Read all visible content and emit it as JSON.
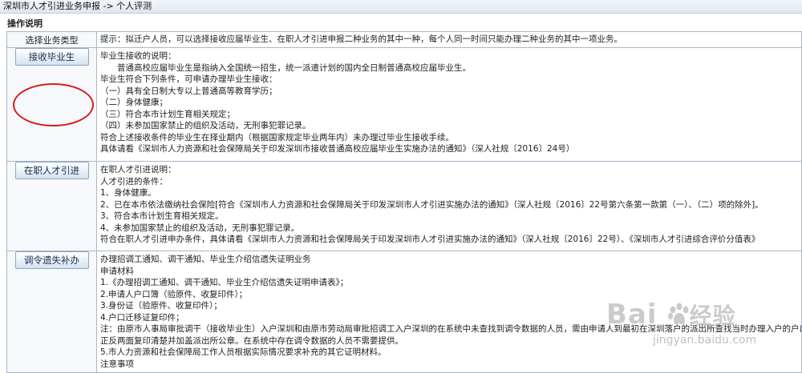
{
  "breadcrumb": "深圳市人才引进业务申报 -> 个人评测",
  "section_title": "操作说明",
  "header_row": {
    "label": "选择业务类型",
    "hint": "提示：拟迁户人员，可以选择接收应届毕业生、在职人才引进申报二种业务的其中一种，每个人同一时间只能办理二种业务的其中一项业务。"
  },
  "rows": [
    {
      "button": "接收毕业生",
      "lines": [
        "毕业生接收的说明：",
        "　　普通高校应届毕业生是指纳入全国统一招生，统一派遣计划的国内全日制普通高校应届毕业生。",
        "毕业生符合下列条件，可申请办理毕业生接收：",
        "（一）具有全日制大专以上普通高等教育学历；",
        "（二）身体健康；",
        "（三）符合本市计划生育相关规定；",
        "（四）未参加国家禁止的组织及活动，无刑事犯罪记录。",
        "符合上述接收条件的毕业生在择业期内（根据国家规定毕业两年内）未办理过毕业生接收手续。",
        "具体请看《深圳市人力资源和社会保障局关于印发深圳市接收普通高校应届毕业生实施办法的通知》（深人社规〔2016〕24号）"
      ]
    },
    {
      "button": "在职人才引进",
      "lines": [
        "在职人才引进说明：",
        "人才引进的条件：",
        "1、身体健康。",
        "2、已在本市依法缴纳社会保险[符合《深圳市人力资源和社会保障局关于印发深圳市人才引进实施办法的通知》（深人社规〔2016〕22号第六条第一款第（一）、（二）项的除外]。",
        "3、符合本市计划生育相关规定。",
        "4、未参加国家禁止的组织及活动，无刑事犯罪记录。",
        "符合在职人才引进申办条件，具体请看《深圳市人力资源和社会保障局关于印发深圳市人才引进实施办法的通知》（深人社规〔2016〕22号）、《深圳市人才引进综合评价分值表》"
      ]
    },
    {
      "button": "调令遗失补办",
      "lines": [
        "办理招调工通知、调干通知、毕业生介绍信遗失证明业务",
        "申请材料",
        "1.《办理招调工通知、调干通知、毕业生介绍信遗失证明申请表》；",
        "2.申请人户口簿（验原件、收复印件）；",
        "3.身份证（验原件、收复印件）；",
        "4.户口迁移证复印件；",
        "注：由原市人事局审批调干（接收毕业生）入户深圳和由原市劳动局审批招调工入户深圳的在系统中未查找到调令数据的人员，需由申请人到最初在深圳落户的派出所查找当时办理入户的户口迁移证，",
        "正反两面复印清楚并加盖派出所公章。在系统中存在调令数据的人员不需要提供。",
        "5.市人力资源和社会保障局工作人员根据实际情况要求补充的其它证明材料。",
        "注意事项"
      ]
    }
  ],
  "watermark": {
    "logo": "Bai",
    "logo_tail": "经验",
    "url": "jingyan.baidu.com"
  }
}
